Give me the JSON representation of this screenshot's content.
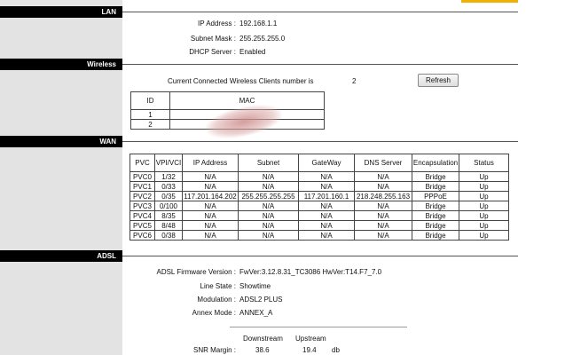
{
  "sections": {
    "lan": "LAN",
    "wireless": "Wireless",
    "wan": "WAN",
    "adsl": "ADSL"
  },
  "lan": {
    "ip_label": "IP Address :",
    "ip_value": "192.168.1.1",
    "mask_label": "Subnet Mask :",
    "mask_value": "255.255.255.0",
    "dhcp_label": "DHCP Server :",
    "dhcp_value": "Enabled"
  },
  "wireless": {
    "clients_text": "Current Connected Wireless Clients number is",
    "clients_count": "2",
    "refresh_label": "Refresh",
    "headers": [
      "ID",
      "MAC"
    ],
    "rows": [
      {
        "id": "1",
        "mac": ""
      },
      {
        "id": "2",
        "mac": ""
      }
    ]
  },
  "wan": {
    "headers": [
      "PVC",
      "VPI/VCI",
      "IP Address",
      "Subnet",
      "GateWay",
      "DNS Server",
      "Encapsulation",
      "Status"
    ],
    "rows": [
      [
        "PVC0",
        "1/32",
        "N/A",
        "N/A",
        "N/A",
        "N/A",
        "Bridge",
        "Up"
      ],
      [
        "PVC1",
        "0/33",
        "N/A",
        "N/A",
        "N/A",
        "N/A",
        "Bridge",
        "Up"
      ],
      [
        "PVC2",
        "0/35",
        "117.201.164.202",
        "255.255.255.255",
        "117.201.160.1",
        "218.248.255.163",
        "PPPoE",
        "Up"
      ],
      [
        "PVC3",
        "0/100",
        "N/A",
        "N/A",
        "N/A",
        "N/A",
        "Bridge",
        "Up"
      ],
      [
        "PVC4",
        "8/35",
        "N/A",
        "N/A",
        "N/A",
        "N/A",
        "Bridge",
        "Up"
      ],
      [
        "PVC5",
        "8/48",
        "N/A",
        "N/A",
        "N/A",
        "N/A",
        "Bridge",
        "Up"
      ],
      [
        "PVC6",
        "0/38",
        "N/A",
        "N/A",
        "N/A",
        "N/A",
        "Bridge",
        "Up"
      ]
    ]
  },
  "adsl": {
    "firmware_label": "ADSL Firmware Version :",
    "firmware_value": "FwVer:3.12.8.31_TC3086 HwVer:T14.F7_7.0",
    "line_label": "Line State :",
    "line_value": "Showtime",
    "mod_label": "Modulation :",
    "mod_value": "ADSL2 PLUS",
    "annex_label": "Annex Mode :",
    "annex_value": "ANNEX_A",
    "downstream_label": "Downstream",
    "upstream_label": "Upstream",
    "snr_label": "SNR Margin :",
    "snr_down": "38.6",
    "snr_up": "19.4",
    "snr_unit": "db"
  },
  "colors": {
    "sidebar": "#e3e3e3",
    "section_bar": "#000000",
    "accent": "#f0b000"
  }
}
